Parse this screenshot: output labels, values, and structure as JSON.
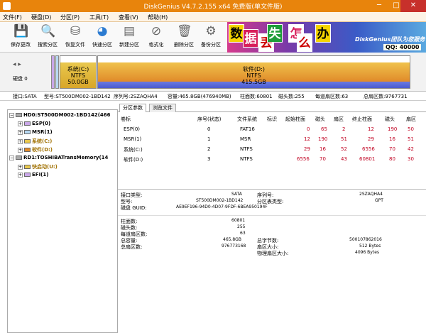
{
  "window": {
    "title": "DiskGenius V4.7.2.155 x64 免费版(单文件版)",
    "min": "─",
    "max": "□",
    "close": "✕"
  },
  "menu": [
    "文件(F)",
    "硬盘(D)",
    "分区(P)",
    "工具(T)",
    "查看(V)",
    "帮助(H)"
  ],
  "toolbar": [
    {
      "label": "保存更改",
      "icon": "save-icon"
    },
    {
      "label": "搜索分区",
      "icon": "search-icon"
    },
    {
      "label": "恢复文件",
      "icon": "recover-icon"
    },
    {
      "label": "快速分区",
      "icon": "quick-partition-icon"
    },
    {
      "label": "新建分区",
      "icon": "new-partition-icon"
    },
    {
      "label": "格式化",
      "icon": "format-icon"
    },
    {
      "label": "删除分区",
      "icon": "delete-icon"
    },
    {
      "label": "备份分区",
      "icon": "backup-icon"
    }
  ],
  "banner": {
    "chars": [
      "数",
      "据",
      "丢",
      "失",
      "怎",
      "么",
      "办"
    ],
    "team": "DiskGenius团队为您服务",
    "qq": "QQ: 40000"
  },
  "diskmap": {
    "nav": "◂ ▸",
    "disk_label": "硬盘 0",
    "partitions": [
      {
        "name": "系统(C:)",
        "fs": "NTFS",
        "size": "50.0GB"
      },
      {
        "name": "软件(D:)",
        "fs": "NTFS",
        "size": "415.5GB"
      }
    ]
  },
  "infobar": {
    "interface": "接口:SATA",
    "model": "型号:ST500DM002-1BD142",
    "serial": "序列号:2SZAQHA4",
    "capacity": "容量:465.8GB(476940MB)",
    "cylinders": "柱面数:60801",
    "heads": "磁头数:255",
    "sectors_per_track": "每道扇区数:63",
    "total_sectors": "总扇区数:9767731"
  },
  "tree": {
    "hd0": "HD0:ST500DM002-1BD142(466",
    "hd0_parts": [
      "ESP(0)",
      "MSR(1)",
      "系统(C:)",
      "软件(D:)"
    ],
    "rd1": "RD1:TOSHIBATransMemory(14",
    "rd1_parts": [
      "快启动(U:)",
      "EFI(1)"
    ]
  },
  "tabs": [
    "分区参数",
    "浏览文件"
  ],
  "partition_table": {
    "headers": [
      "卷标",
      "序号(状态)",
      "文件系统",
      "标识",
      "起始柱面",
      "磁头",
      "扇区",
      "终止柱面",
      "磁头",
      "扇区"
    ],
    "rows": [
      {
        "name": "ESP(0)",
        "no": "0",
        "fs": "FAT16",
        "id": "",
        "sc": "0",
        "sh": "65",
        "ss": "2",
        "ec": "12",
        "eh": "190",
        "es": "50"
      },
      {
        "name": "MSR(1)",
        "no": "1",
        "fs": "MSR",
        "id": "",
        "sc": "12",
        "sh": "190",
        "ss": "51",
        "ec": "29",
        "eh": "16",
        "es": "51"
      },
      {
        "name": "系统(C:)",
        "no": "2",
        "fs": "NTFS",
        "id": "",
        "sc": "29",
        "sh": "16",
        "ss": "52",
        "ec": "6556",
        "eh": "70",
        "es": "42"
      },
      {
        "name": "软件(D:)",
        "no": "3",
        "fs": "NTFS",
        "id": "",
        "sc": "6556",
        "sh": "70",
        "ss": "43",
        "ec": "60801",
        "eh": "80",
        "es": "30"
      }
    ]
  },
  "details": {
    "interface_label": "接口类型:",
    "interface_value": "SATA",
    "serial_label": "序列号:",
    "serial_value": "2SZAQHA4",
    "model_label": "型号:",
    "model_value": "ST500DM002-1BD142",
    "ptype_label": "分区表类型:",
    "ptype_value": "GPT",
    "guid_label": "磁盘 GUID:",
    "guid_value": "AE9EF196-94D0-4D07-9FDF-6BEA950194F",
    "cyl_label": "柱面数:",
    "cyl_value": "60801",
    "heads_label": "磁头数:",
    "heads_value": "255",
    "spt_label": "每道扇区数:",
    "spt_value": "63",
    "cap_label": "总容量:",
    "cap_value": "465.8GB",
    "bytes_label": "总字节数:",
    "bytes_value": "500107862016",
    "tsec_label": "总扇区数:",
    "tsec_value": "976773168",
    "secsize_label": "扇区大小:",
    "secsize_value": "512 Bytes",
    "phys_label": "物理扇区大小:",
    "phys_value": "4096 Bytes"
  }
}
